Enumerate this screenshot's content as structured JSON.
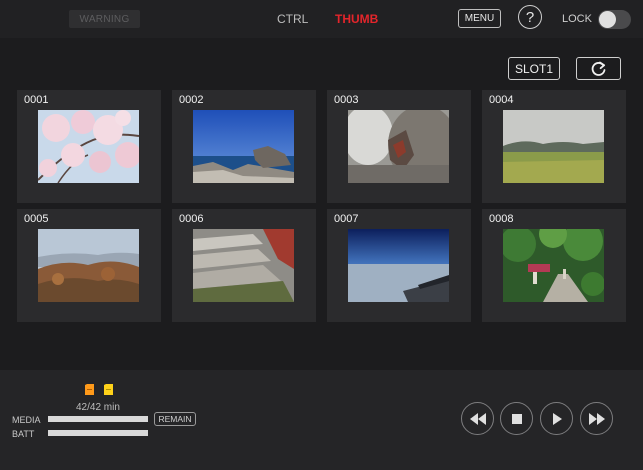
{
  "header": {
    "warning_label": "WARNING",
    "tabs": [
      {
        "label": "CTRL",
        "active": false
      },
      {
        "label": "THUMB",
        "active": true
      }
    ],
    "menu_label": "MENU",
    "help_label": "?",
    "lock_label": "LOCK",
    "lock_on": false
  },
  "toolbar": {
    "slot_label": "SLOT1",
    "refresh_icon": "refresh-icon"
  },
  "thumbnails": [
    {
      "number": "0001",
      "scene": "cherry-blossoms"
    },
    {
      "number": "0002",
      "scene": "coastal-rocks"
    },
    {
      "number": "0003",
      "scene": "rock-closeup"
    },
    {
      "number": "0004",
      "scene": "rice-field"
    },
    {
      "number": "0005",
      "scene": "mountain-view"
    },
    {
      "number": "0006",
      "scene": "stone-steps"
    },
    {
      "number": "0007",
      "scene": "airplane-wing-sky"
    },
    {
      "number": "0008",
      "scene": "forest-path"
    }
  ],
  "status": {
    "sd_icons": [
      {
        "name": "sd-card-icon",
        "color": "#ff9a1a"
      },
      {
        "name": "sd-card-icon",
        "color": "#ffd21a"
      }
    ],
    "media_time": "42/42 min",
    "media_label": "MEDIA",
    "batt_label": "BATT",
    "media_level": 1.0,
    "batt_level": 1.0,
    "remain_label": "REMAIN"
  },
  "transport": [
    "rewind-icon",
    "stop-icon",
    "play-icon",
    "fast-forward-icon"
  ],
  "colors": {
    "active_tab": "#e4252b",
    "background": "#1c1c1e"
  }
}
